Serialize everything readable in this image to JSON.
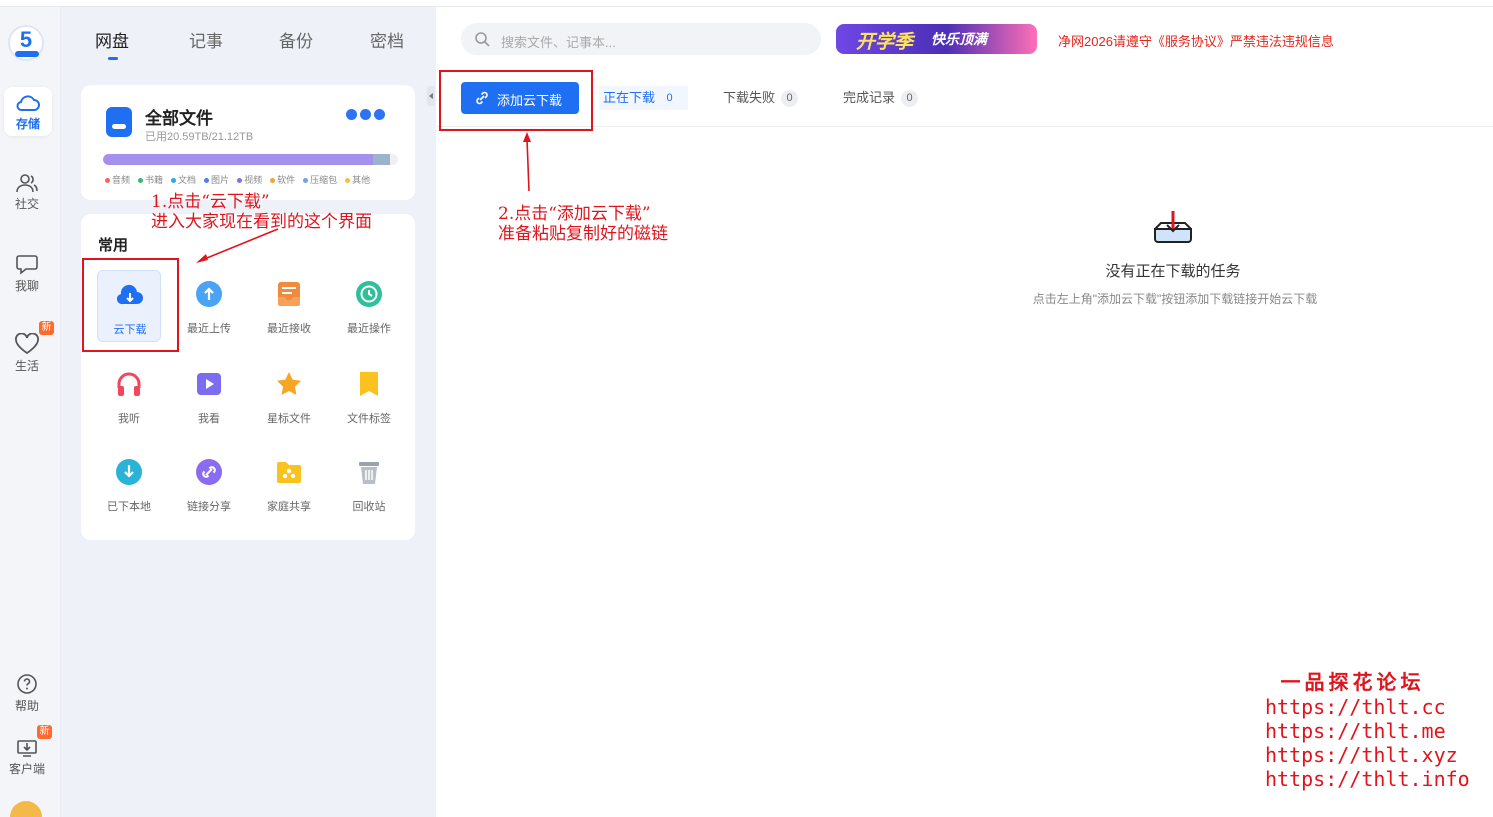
{
  "rail": {
    "logo_text": "5",
    "items": [
      {
        "label": "存储",
        "icon": "cloud-icon"
      },
      {
        "label": "社交",
        "icon": "people-icon"
      },
      {
        "label": "我聊",
        "icon": "chat-icon"
      },
      {
        "label": "生活",
        "icon": "heart-icon"
      },
      {
        "label": "帮助",
        "icon": "help-icon"
      },
      {
        "label": "客户端",
        "icon": "download-client-icon"
      }
    ],
    "new_badge": "新"
  },
  "panel": {
    "tabs": [
      "网盘",
      "记事",
      "备份",
      "密档"
    ],
    "files": {
      "title": "全部文件",
      "used": "已用20.59TB/21.12TB",
      "usage_fraction": 0.975,
      "legend": [
        {
          "label": "音频",
          "color": "#f2665a"
        },
        {
          "label": "书籍",
          "color": "#39b86f"
        },
        {
          "label": "文档",
          "color": "#2da8e0"
        },
        {
          "label": "图片",
          "color": "#4e7ef0"
        },
        {
          "label": "视频",
          "color": "#8b6cf0"
        },
        {
          "label": "软件",
          "color": "#f2a43a"
        },
        {
          "label": "压缩包",
          "color": "#73a1d9"
        },
        {
          "label": "其他",
          "color": "#f2c23a"
        }
      ]
    },
    "common": {
      "title": "常用",
      "items": [
        "云下载",
        "最近上传",
        "最近接收",
        "最近操作",
        "我听",
        "我看",
        "星标文件",
        "文件标签",
        "已下本地",
        "链接分享",
        "家庭共享",
        "回收站"
      ]
    }
  },
  "header": {
    "search_placeholder": "搜索文件、记事本...",
    "promo_a": "开学季",
    "promo_b": "快乐顶满",
    "notice": "净网2026请遵守《服务协议》严禁违法违规信息"
  },
  "toolbar": {
    "add_label": "添加云下载",
    "tabs": [
      {
        "label": "正在下载",
        "count": "0"
      },
      {
        "label": "下载失败",
        "count": "0"
      },
      {
        "label": "完成记录",
        "count": "0"
      }
    ]
  },
  "empty": {
    "title": "没有正在下载的任务",
    "hint": "点击左上角\"添加云下载\"按钮添加下载链接开始云下载"
  },
  "annotations": {
    "step1_line1": "1.点击“云下载”",
    "step1_line2": "进入大家现在看到的这个界面",
    "step2_line1": "2.点击“添加云下载”",
    "step2_line2": "准备粘贴复制好的磁链"
  },
  "watermark": {
    "title": "一品探花论坛",
    "urls": [
      "https://thlt.cc",
      "https://thlt.me",
      "https://thlt.xyz",
      "https://thlt.info"
    ]
  },
  "colors": {
    "accent": "#1f6ff2",
    "annotation": "#e0141c"
  }
}
